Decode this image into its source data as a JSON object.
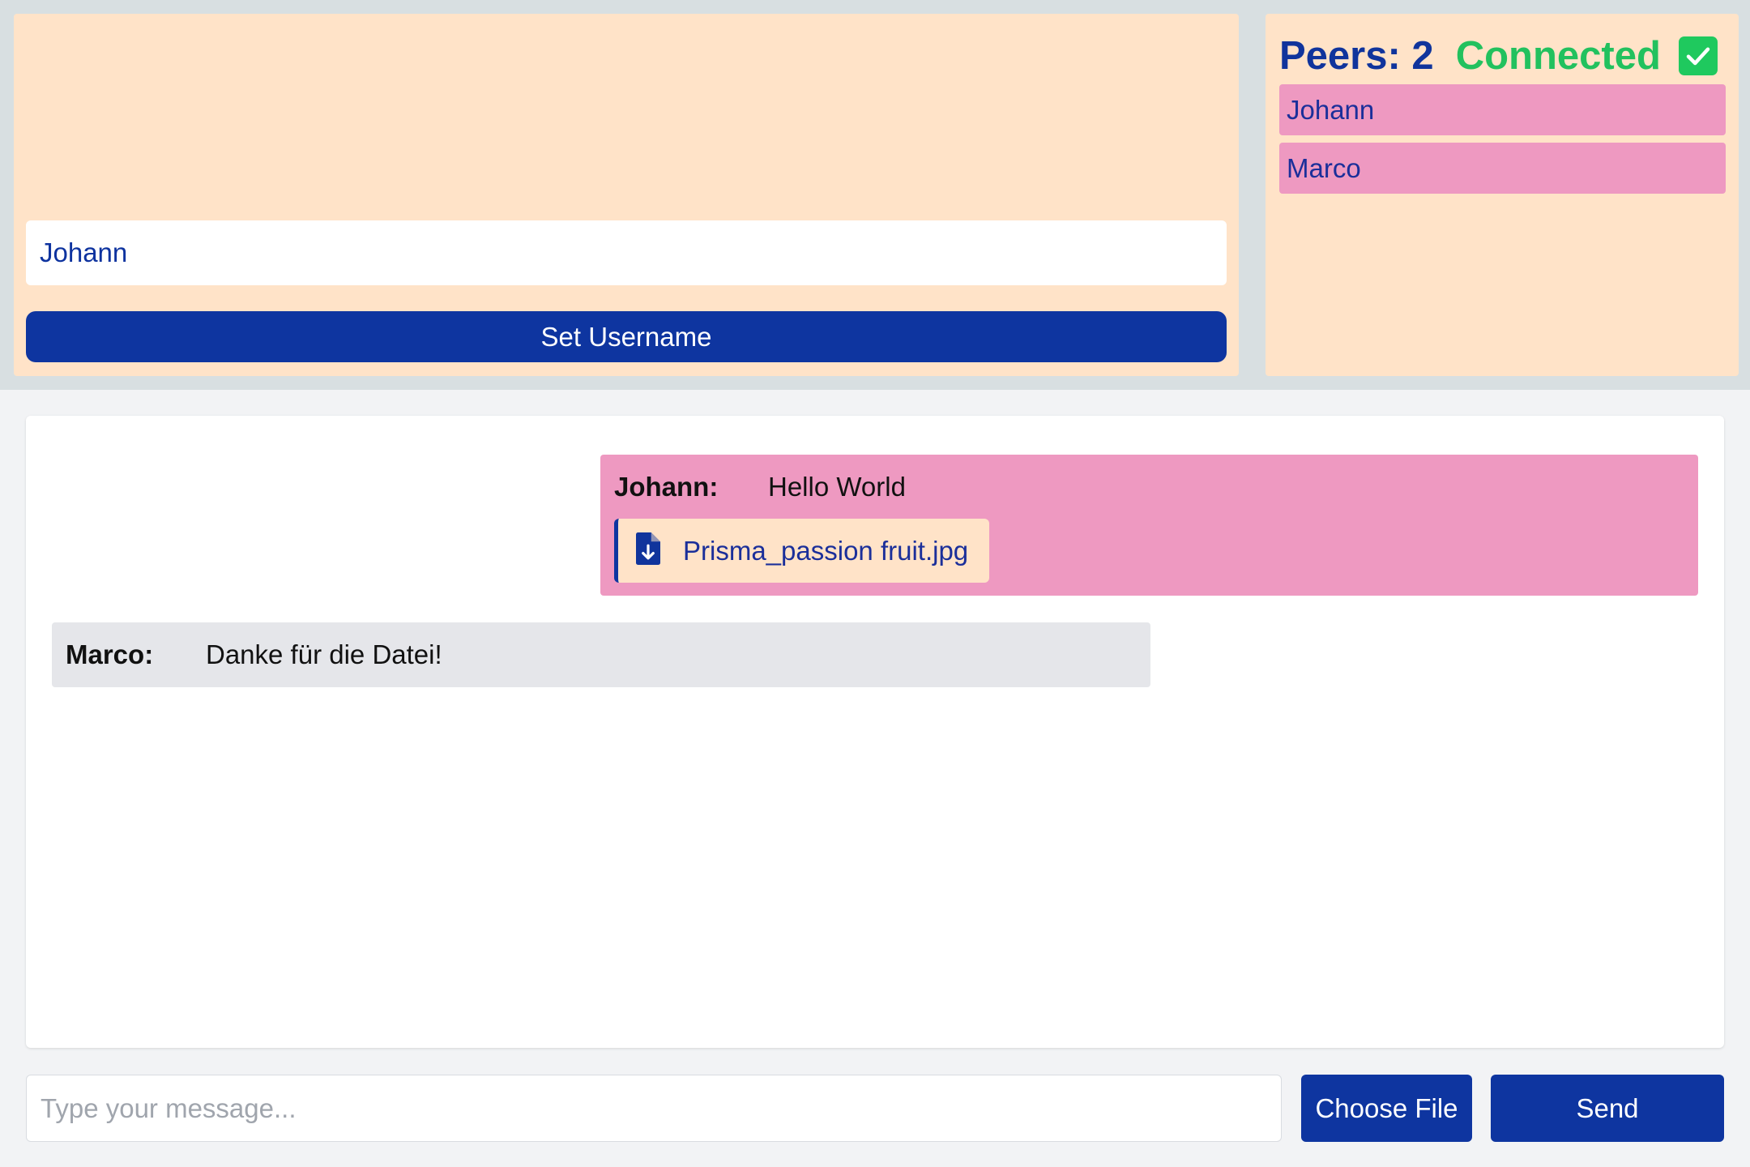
{
  "user_panel": {
    "username_value": "Johann",
    "set_username_label": "Set Username"
  },
  "peers_panel": {
    "peers_label": "Peers: 2",
    "status_text": "Connected",
    "status_icon": "check-icon",
    "peers": [
      {
        "name": "Johann"
      },
      {
        "name": "Marco"
      }
    ]
  },
  "chat": {
    "messages": [
      {
        "sender": "Johann:",
        "text": "Hello World",
        "attachment": {
          "icon": "file-download-icon",
          "filename": "Prisma_passion fruit.jpg"
        }
      },
      {
        "sender": "Marco:",
        "text": "Danke für die Datei!"
      }
    ]
  },
  "composer": {
    "placeholder": "Type your message...",
    "choose_file_label": "Choose File",
    "send_label": "Send"
  },
  "colors": {
    "panel_bg": "#ffe3c8",
    "primary": "#0e35a0",
    "peer_bg": "#ee99c1",
    "connected": "#22c15e",
    "other_message_bg": "#e5e6ea"
  }
}
